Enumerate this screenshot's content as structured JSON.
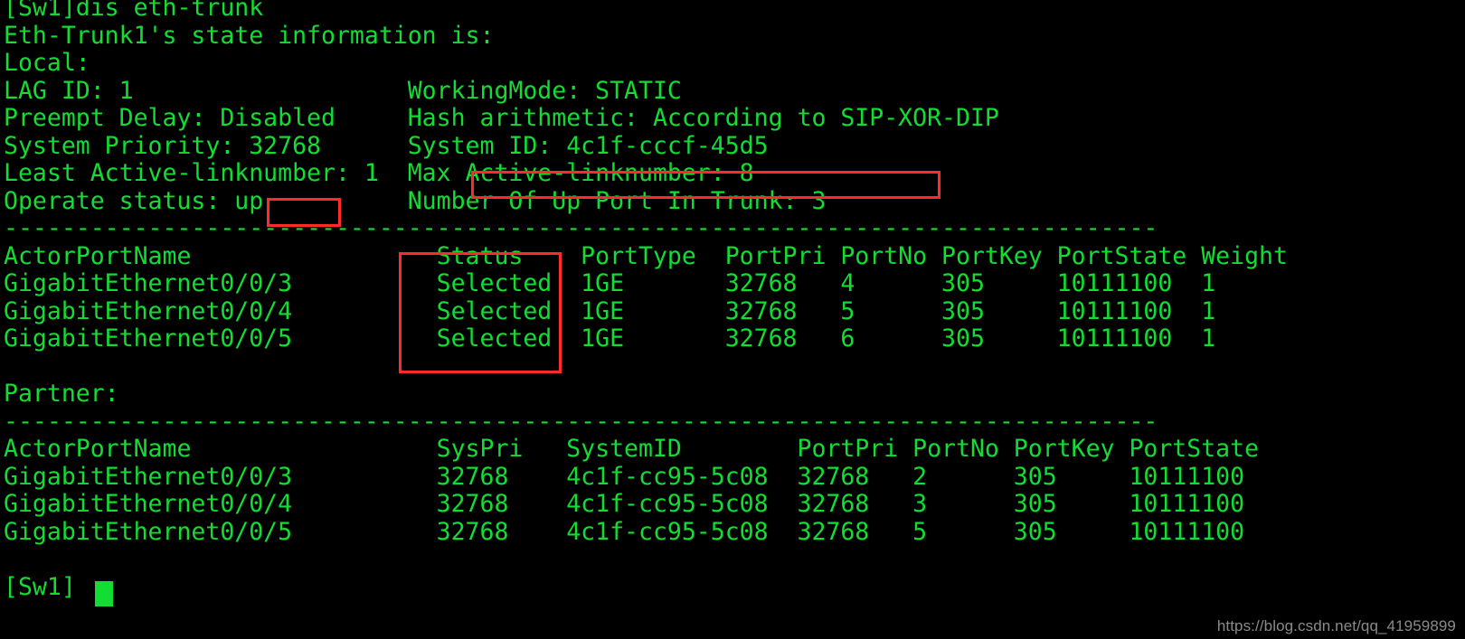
{
  "terminal": {
    "foreground_color": "#11dd33",
    "background_color": "#000000",
    "highlight_color": "#ff2b2b",
    "prompt": "[Sw1]",
    "command": "dis eth-trunk",
    "command_line": "[Sw1]dis eth-trunk",
    "final_prompt": "[Sw1]",
    "separator": "--------------------------------------------------------------------------------",
    "blank": ""
  },
  "header": {
    "title_line": "Eth-Trunk1's state information is:",
    "local_label": "Local:"
  },
  "local_summary": {
    "lag_id_line": "LAG ID: 1                   WorkingMode: STATIC",
    "preempt_line": "Preempt Delay: Disabled     Hash arithmetic: According to SIP-XOR-DIP",
    "sys_priority_line": "System Priority: 32768      System ID: 4c1f-cccf-45d5",
    "least_active_line": "Least Active-linknumber: 1  Max Active-linknumber: 8",
    "operate_line": "Operate status: up          Number Of Up Port In Trunk: 3",
    "fields": {
      "lag_id_label": "LAG ID:",
      "lag_id_value": "1",
      "working_mode_label": "WorkingMode:",
      "working_mode_value": "STATIC",
      "preempt_delay_label": "Preempt Delay:",
      "preempt_delay_value": "Disabled",
      "hash_arithmetic_label": "Hash arithmetic:",
      "hash_arithmetic_value": "According to SIP-XOR-DIP",
      "system_priority_label": "System Priority:",
      "system_priority_value": "32768",
      "system_id_label": "System ID:",
      "system_id_value": "4c1f-cccf-45d5",
      "least_active_label": "Least Active-linknumber:",
      "least_active_value": "1",
      "max_active_label": "Max Active-linknumber:",
      "max_active_value": "8",
      "operate_status_label": "Operate status:",
      "operate_status_value": "up",
      "up_ports_label": "Number Of Up Port In Trunk:",
      "up_ports_value": "3"
    }
  },
  "local_table": {
    "header_line": "ActorPortName                 Status    PortType  PortPri PortNo PortKey PortState Weight",
    "columns": [
      "ActorPortName",
      "Status",
      "PortType",
      "PortPri",
      "PortNo",
      "PortKey",
      "PortState",
      "Weight"
    ],
    "rows": [
      {
        "line": "GigabitEthernet0/0/3          Selected  1GE       32768   4      305     10111100  1",
        "ActorPortName": "GigabitEthernet0/0/3",
        "Status": "Selected",
        "PortType": "1GE",
        "PortPri": "32768",
        "PortNo": "4",
        "PortKey": "305",
        "PortState": "10111100",
        "Weight": "1"
      },
      {
        "line": "GigabitEthernet0/0/4          Selected  1GE       32768   5      305     10111100  1",
        "ActorPortName": "GigabitEthernet0/0/4",
        "Status": "Selected",
        "PortType": "1GE",
        "PortPri": "32768",
        "PortNo": "5",
        "PortKey": "305",
        "PortState": "10111100",
        "Weight": "1"
      },
      {
        "line": "GigabitEthernet0/0/5          Selected  1GE       32768   6      305     10111100  1",
        "ActorPortName": "GigabitEthernet0/0/5",
        "Status": "Selected",
        "PortType": "1GE",
        "PortPri": "32768",
        "PortNo": "6",
        "PortKey": "305",
        "PortState": "10111100",
        "Weight": "1"
      }
    ]
  },
  "partner": {
    "label": "Partner:",
    "header_line": "ActorPortName                 SysPri   SystemID        PortPri PortNo PortKey PortState",
    "columns": [
      "ActorPortName",
      "SysPri",
      "SystemID",
      "PortPri",
      "PortNo",
      "PortKey",
      "PortState"
    ],
    "rows": [
      {
        "line": "GigabitEthernet0/0/3          32768    4c1f-cc95-5c08  32768   2      305     10111100",
        "ActorPortName": "GigabitEthernet0/0/3",
        "SysPri": "32768",
        "SystemID": "4c1f-cc95-5c08",
        "PortPri": "32768",
        "PortNo": "2",
        "PortKey": "305",
        "PortState": "10111100"
      },
      {
        "line": "GigabitEthernet0/0/4          32768    4c1f-cc95-5c08  32768   3      305     10111100",
        "ActorPortName": "GigabitEthernet0/0/4",
        "SysPri": "32768",
        "SystemID": "4c1f-cc95-5c08",
        "PortPri": "32768",
        "PortNo": "3",
        "PortKey": "305",
        "PortState": "10111100"
      },
      {
        "line": "GigabitEthernet0/0/5          32768    4c1f-cc95-5c08  32768   5      305     10111100",
        "ActorPortName": "GigabitEthernet0/0/5",
        "SysPri": "32768",
        "SystemID": "4c1f-cc95-5c08",
        "PortPri": "32768",
        "PortNo": "5",
        "PortKey": "305",
        "PortState": "10111100"
      }
    ]
  },
  "annotations": {
    "box_operate_status": "up",
    "box_max_active_linknumber": "Max Active-linknumber: 8",
    "box_status_column": "Status / Selected / Selected / Selected"
  },
  "watermark": {
    "text": "https://blog.csdn.net/qq_41959899"
  }
}
